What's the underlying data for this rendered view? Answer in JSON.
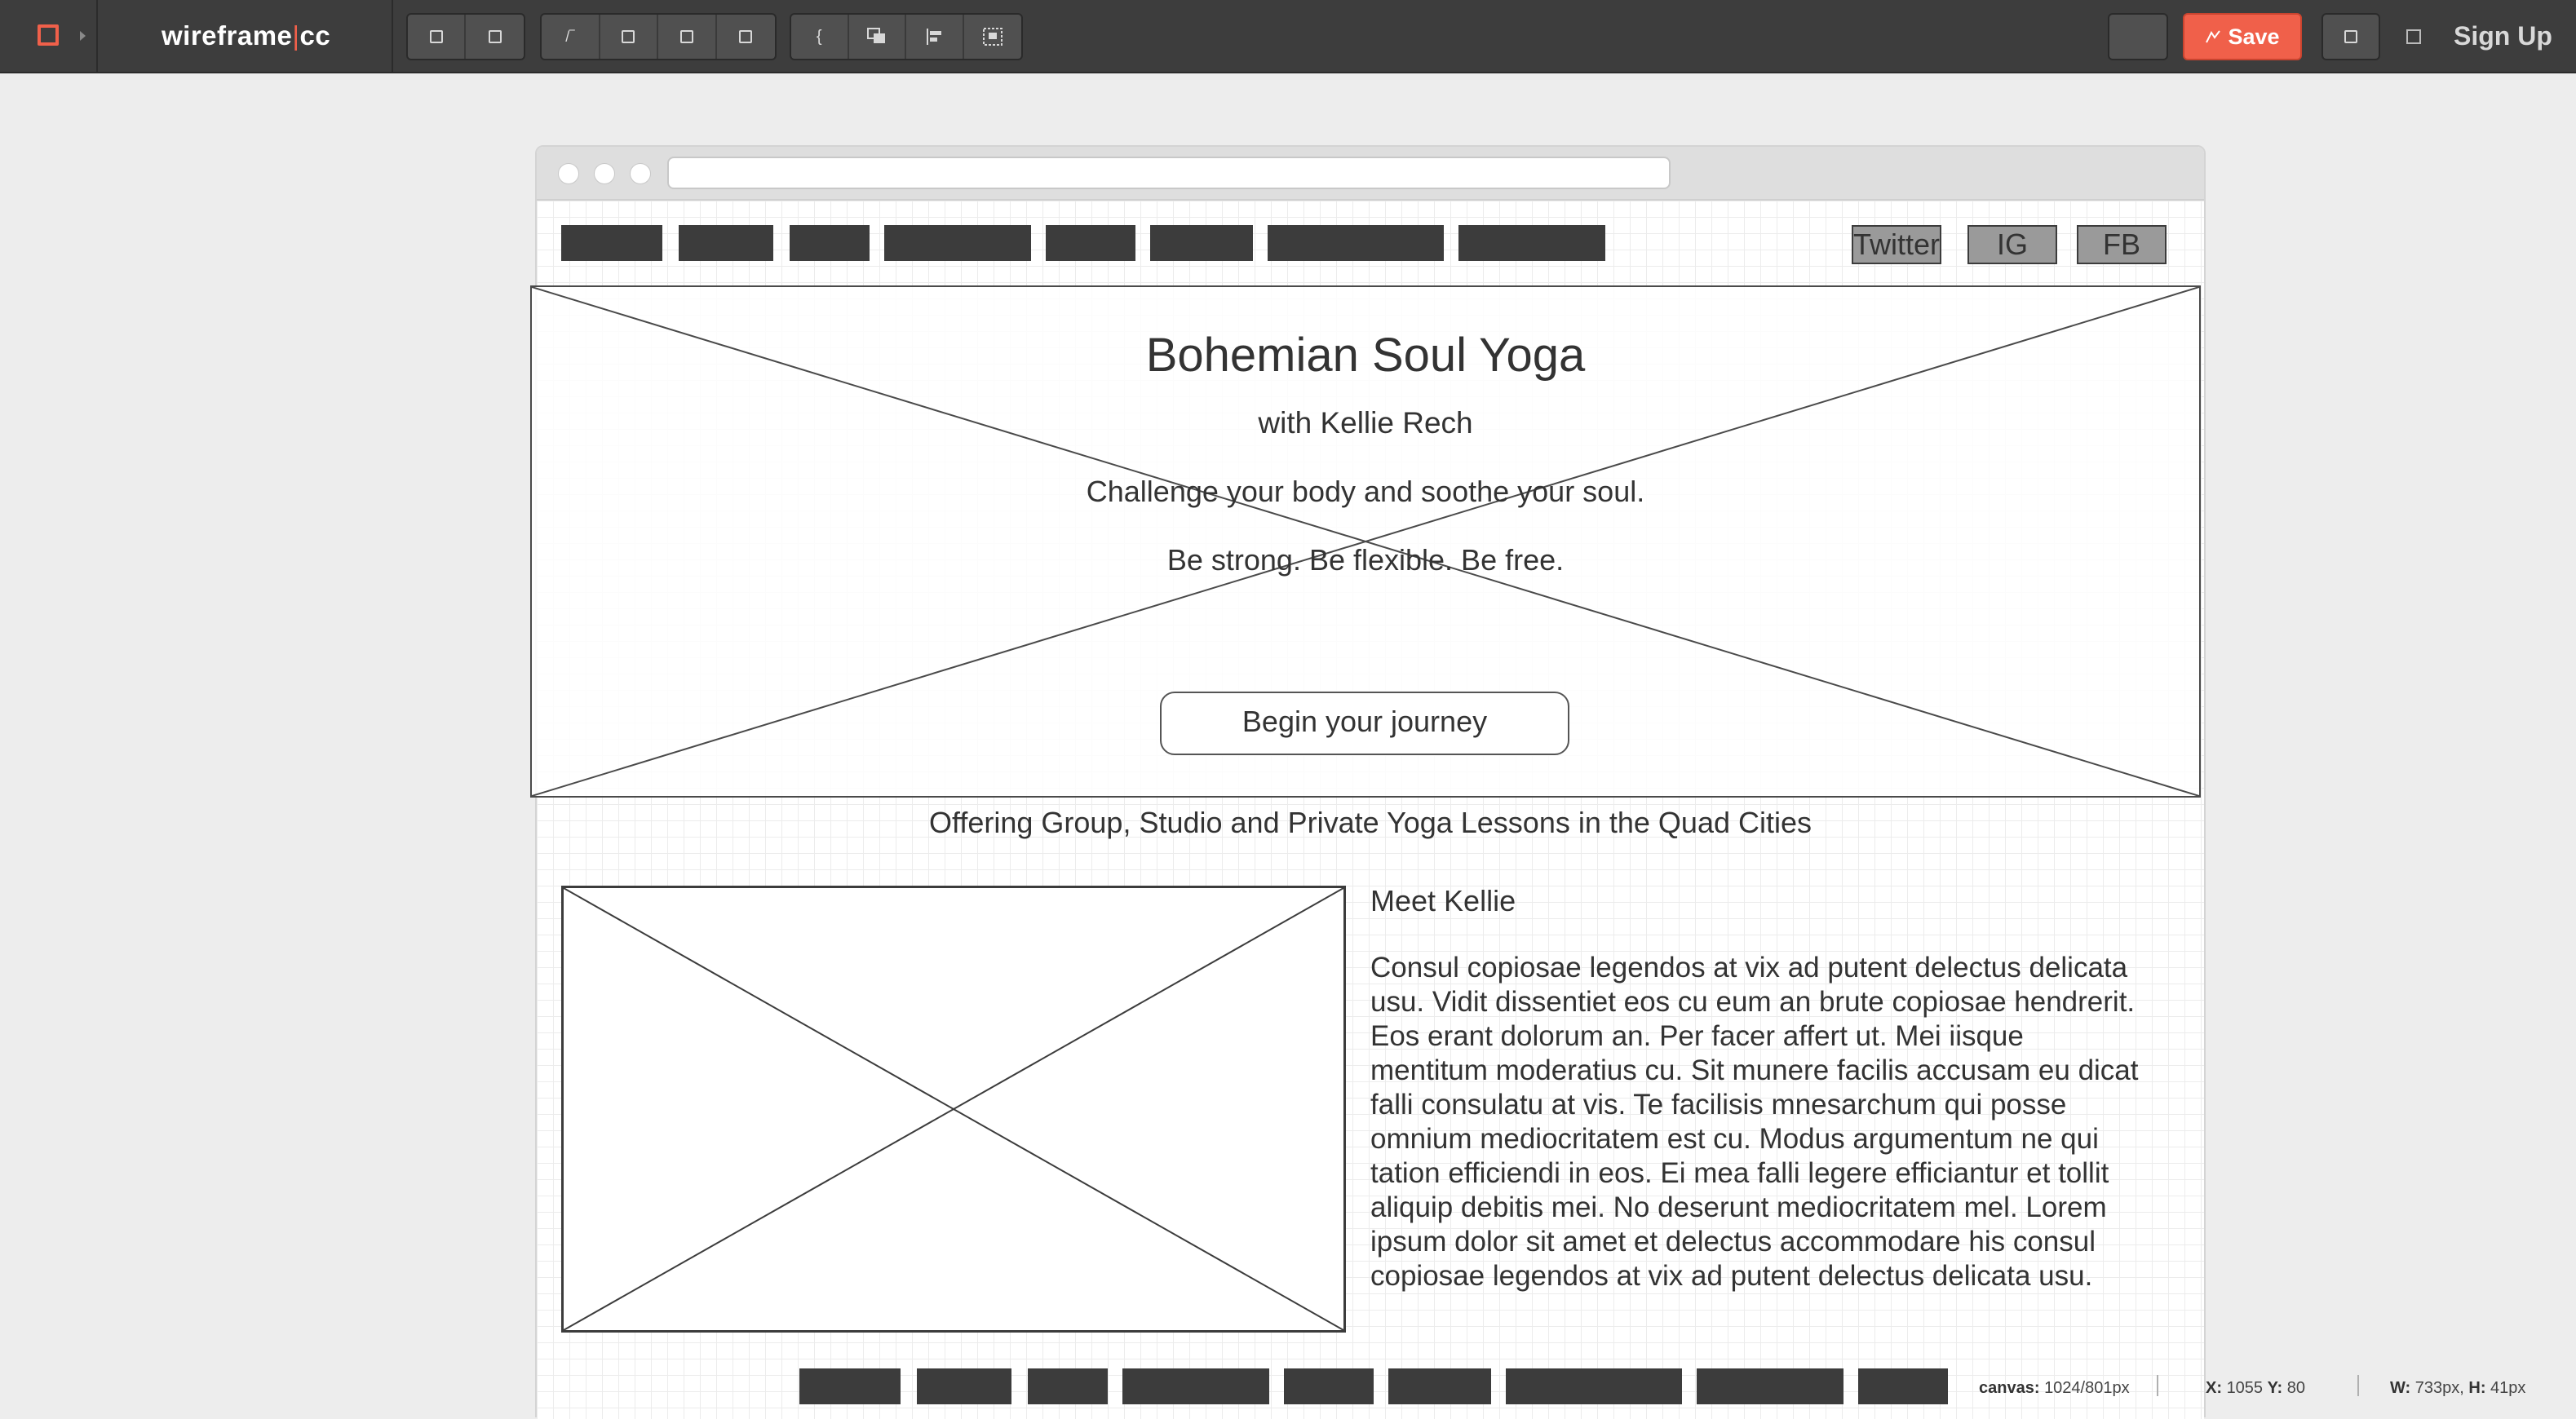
{
  "app": {
    "brand_left": "wireframe",
    "brand_pipe": "|",
    "brand_right": "cc",
    "save_label": "Save",
    "signup_label": "Sign Up",
    "accent": "#f0604a"
  },
  "toolbar": {
    "group1": [
      "square-icon",
      "square-icon"
    ],
    "group2_first": "/‾",
    "group2": [
      "square-icon",
      "square-icon",
      "square-icon"
    ],
    "group3_first": "{"
  },
  "wireframe": {
    "social": [
      "Twitter",
      "IG",
      "FB"
    ],
    "hero": {
      "title": "Bohemian Soul Yoga",
      "subtitle": "with Kellie Rech",
      "line1": "Challenge your body and soothe your soul.",
      "line2": "Be strong. Be flexible. Be free.",
      "cta": "Begin your journey"
    },
    "tagline": "Offering Group, Studio and Private Yoga Lessons in the Quad Cities",
    "about": {
      "heading": "Meet Kellie",
      "body": "Consul copiosae legendos at vix ad putent delectus delicata usu. Vidit dissentiet eos cu eum an brute copiosae hendrerit. Eos erant dolorum an. Per facer affert ut. Mei iisque mentitum moderatius cu. Sit munere facilis accusam eu dicat falli consulatu at vis. Te facilisis mnesarchum qui posse omnium mediocritatem est cu. Modus argumentum ne qui tation efficiendi in eos. Ei mea falli legere efficiantur et tollit aliquip debitis mei. No deserunt mediocritatem mel. Lorem ipsum dolor sit amet et delectus accommodare his consul copiosae legendos at vix ad putent delectus delicata usu."
    }
  },
  "status": {
    "canvas_label": "canvas:",
    "canvas_value": "1024/801px",
    "x_label": "X:",
    "x_value": "1055",
    "y_label": "Y:",
    "y_value": "80",
    "w_label": "W:",
    "w_value": "733px,",
    "h_label": "H:",
    "h_value": "41px"
  }
}
